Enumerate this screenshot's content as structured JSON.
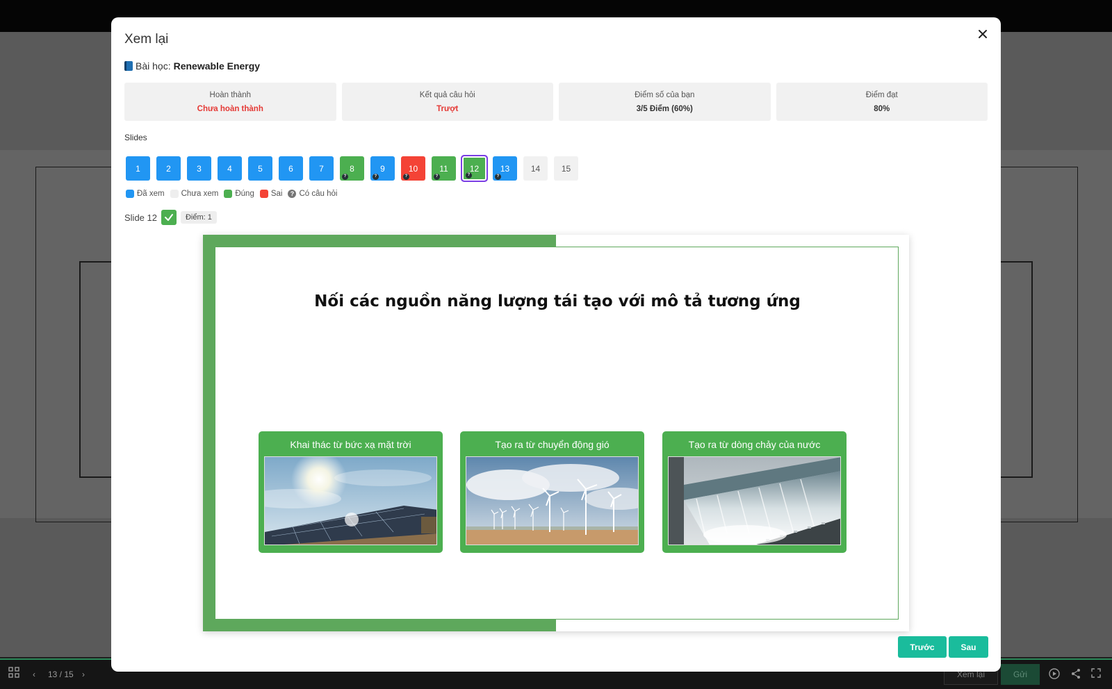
{
  "background": {
    "page_counter": "13 / 15",
    "review_button": "Xem lại",
    "send_button": "Gửi"
  },
  "modal": {
    "title": "Xem lại",
    "lesson_prefix": "Bài học:",
    "lesson_name": "Renewable Energy",
    "stats": [
      {
        "label": "Hoàn thành",
        "value": "Chưa hoàn thành",
        "color": "#e53935"
      },
      {
        "label": "Kết quả câu hỏi",
        "value": "Trượt",
        "color": "#e53935"
      },
      {
        "label": "Điểm số của bạn",
        "value": "3/5 Điểm (60%)",
        "color": "#333333"
      },
      {
        "label": "Điểm đạt",
        "value": "80%",
        "color": "#333333"
      }
    ],
    "slides_label": "Slides",
    "slides": [
      {
        "num": "1",
        "status": "viewed",
        "question": false
      },
      {
        "num": "2",
        "status": "viewed",
        "question": false
      },
      {
        "num": "3",
        "status": "viewed",
        "question": false
      },
      {
        "num": "4",
        "status": "viewed",
        "question": false
      },
      {
        "num": "5",
        "status": "viewed",
        "question": false
      },
      {
        "num": "6",
        "status": "viewed",
        "question": false
      },
      {
        "num": "7",
        "status": "viewed",
        "question": false
      },
      {
        "num": "8",
        "status": "correct",
        "question": true
      },
      {
        "num": "9",
        "status": "viewed",
        "question": true
      },
      {
        "num": "10",
        "status": "wrong",
        "question": true
      },
      {
        "num": "11",
        "status": "correct",
        "question": true
      },
      {
        "num": "12",
        "status": "correct",
        "question": true,
        "current": true
      },
      {
        "num": "13",
        "status": "viewed",
        "question": true
      },
      {
        "num": "14",
        "status": "unviewed",
        "question": false
      },
      {
        "num": "15",
        "status": "unviewed",
        "question": false
      }
    ],
    "legend": {
      "viewed": "Đã xem",
      "unviewed": "Chưa xem",
      "correct": "Đúng",
      "wrong": "Sai",
      "question": "Có câu hỏi",
      "question_symbol": "?"
    },
    "current_slide_label": "Slide 12",
    "score_badge": "Điểm: 1",
    "slide": {
      "title": "Nối các nguồn năng lượng tái tạo với mô tả tương ứng",
      "cards": [
        {
          "title": "Khai thác từ bức xạ mặt trời",
          "image": "solar-panels"
        },
        {
          "title": "Tạo ra từ chuyển động gió",
          "image": "wind-turbines"
        },
        {
          "title": "Tạo ra từ dòng chảy của nước",
          "image": "dam-spillway"
        }
      ]
    },
    "prev_button": "Trước",
    "next_button": "Sau"
  },
  "colors": {
    "viewed": "#2196f3",
    "correct": "#4caf50",
    "wrong": "#f44336",
    "unviewed": "#f1f1f1",
    "current_outline": "#7b3fe4",
    "accent": "#1abc9c",
    "slide_green": "#5ea85c"
  }
}
